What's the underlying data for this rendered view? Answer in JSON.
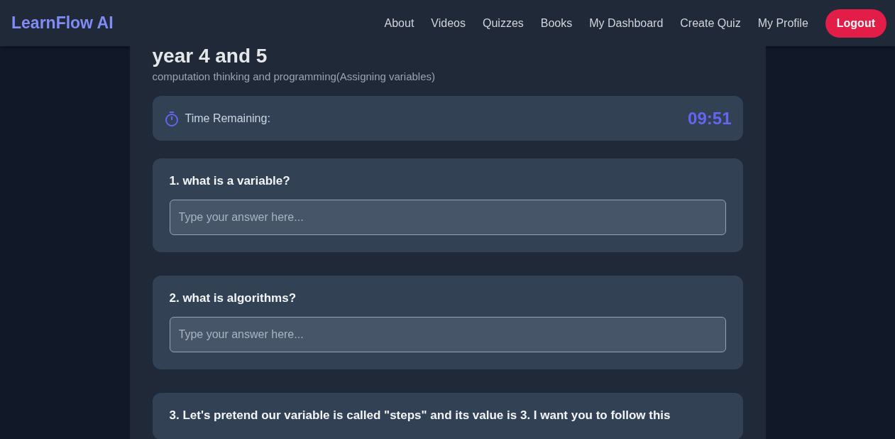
{
  "brand": "LearnFlow AI",
  "nav": [
    {
      "label": "About",
      "kind": "link"
    },
    {
      "label": "Videos",
      "kind": "link"
    },
    {
      "label": "Quizzes",
      "kind": "link"
    },
    {
      "label": "Books",
      "kind": "link"
    },
    {
      "label": "My Dashboard",
      "kind": "link"
    },
    {
      "label": "Create Quiz",
      "kind": "link"
    },
    {
      "label": "My Profile",
      "kind": "link"
    },
    {
      "label": "Logout",
      "kind": "button"
    }
  ],
  "quiz": {
    "title": "year 4 and 5",
    "subtitle": "computation thinking and programming(Assigning variables)"
  },
  "timer": {
    "label": "Time Remaining:",
    "value": "09:51"
  },
  "questions": [
    {
      "text": "1. what is a variable?",
      "placeholder": "Type your answer here..."
    },
    {
      "text": "2. what is algorithms?",
      "placeholder": "Type your answer here..."
    },
    {
      "text": "3. Let's pretend our variable is called \"steps\" and its value is 3. I want you to follow this"
    }
  ]
}
